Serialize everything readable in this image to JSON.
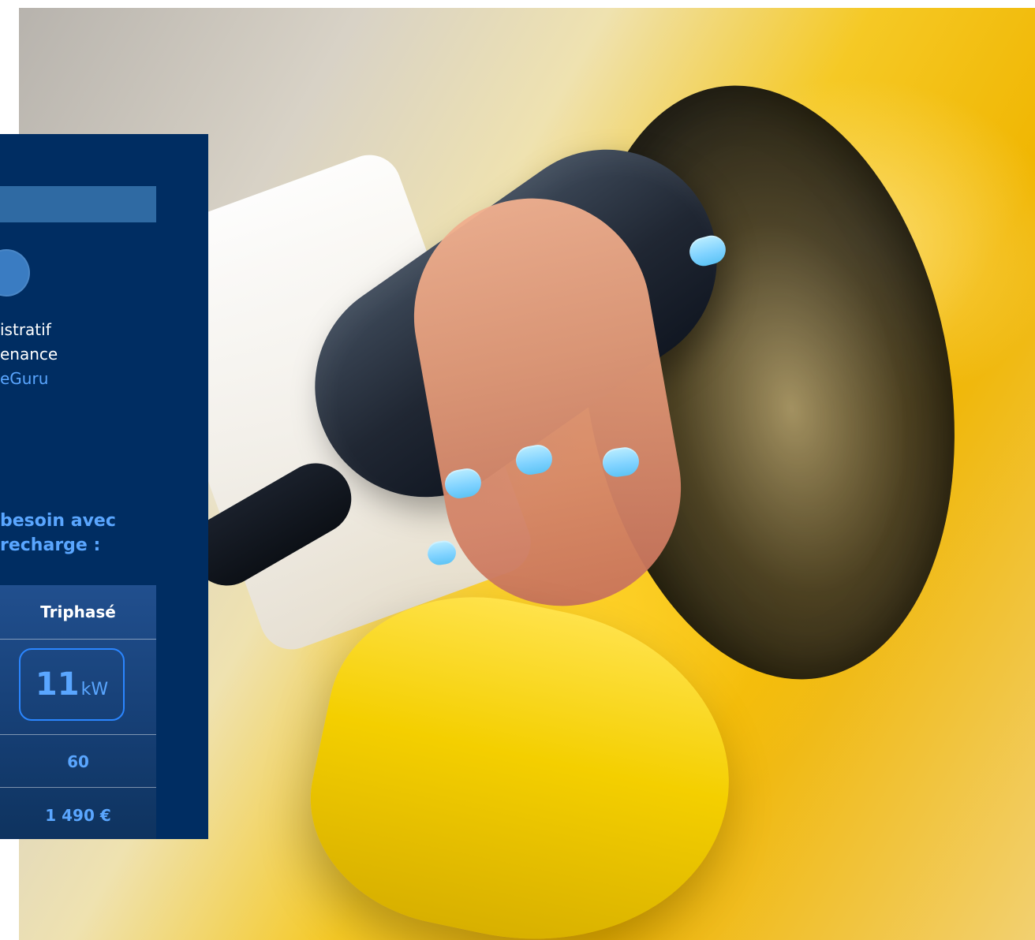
{
  "panel": {
    "lines": [
      "istratif",
      "enance",
      "eGuru"
    ],
    "heading": [
      "besoin avec",
      "recharge :"
    ],
    "table": {
      "header": "Triphasé",
      "power": {
        "value": "11",
        "unit": "kW"
      },
      "rows": [
        "60",
        "1 490 €"
      ]
    }
  },
  "colors": {
    "panel_bg": "#002d62",
    "accent_blue": "#5aa6ff",
    "bar_blue": "#2f6aa3",
    "outline_blue": "#2b86ff"
  }
}
